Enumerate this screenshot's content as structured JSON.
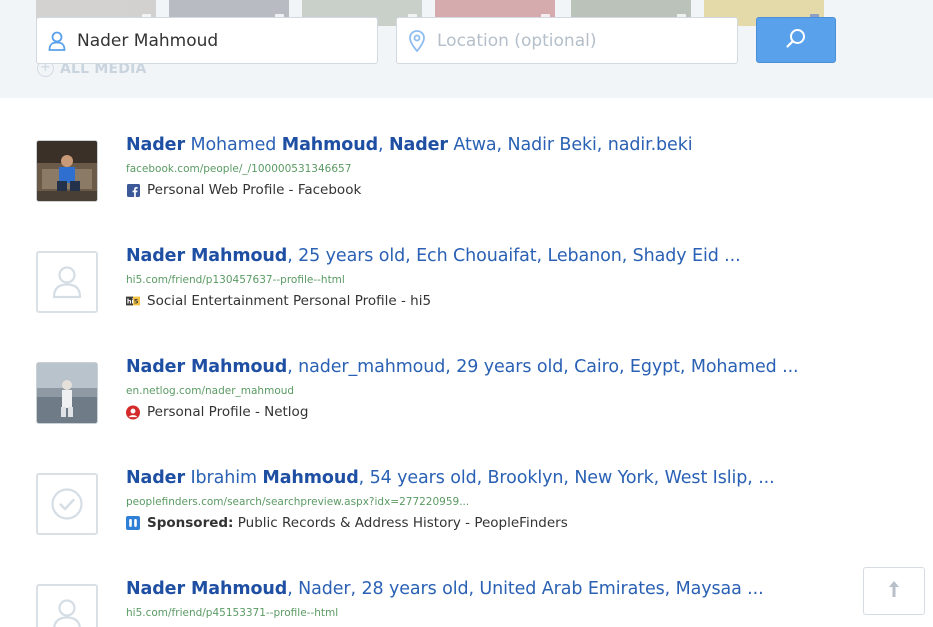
{
  "search": {
    "name_value": "Nader Mahmoud",
    "location_placeholder": "Location (optional)",
    "all_media_label": "ALL MEDIA"
  },
  "colors": {
    "accent": "#5aa1ec",
    "link": "#2a61b4",
    "url": "#5a9a63"
  },
  "results": [
    {
      "title_parts": [
        {
          "text": "Nader",
          "bold": true
        },
        {
          "text": " Mohamed ",
          "bold": false
        },
        {
          "text": "Mahmoud",
          "bold": true
        },
        {
          "text": ", ",
          "bold": false
        },
        {
          "text": "Nader",
          "bold": true
        },
        {
          "text": " Atwa, Nadir Beki, nadir.beki",
          "bold": false
        }
      ],
      "url": "facebook.com/people/_/100000531346657",
      "source_prefix": "",
      "source": "Personal Web Profile - Facebook",
      "source_icon": "facebook-icon",
      "avatar": "photo"
    },
    {
      "title_parts": [
        {
          "text": "Nader Mahmoud",
          "bold": true
        },
        {
          "text": ", 25 years old, Ech Chouaifat, Lebanon, Shady Eid ...",
          "bold": false
        }
      ],
      "url": "hi5.com/friend/p130457637--profile--html",
      "source_prefix": "",
      "source": "Social Entertainment Personal Profile - hi5",
      "source_icon": "hi5-icon",
      "avatar": "placeholder"
    },
    {
      "title_parts": [
        {
          "text": "Nader Mahmoud",
          "bold": true
        },
        {
          "text": ", nader_mahmoud, 29 years old, Cairo, Egypt, Mohamed ...",
          "bold": false
        }
      ],
      "url": "en.netlog.com/nader_mahmoud",
      "source_prefix": "",
      "source": "Personal Profile - Netlog",
      "source_icon": "netlog-icon",
      "avatar": "photo"
    },
    {
      "title_parts": [
        {
          "text": "Nader",
          "bold": true
        },
        {
          "text": " Ibrahim ",
          "bold": false
        },
        {
          "text": "Mahmoud",
          "bold": true
        },
        {
          "text": ", 54 years old, Brooklyn, New York, West Islip, ...",
          "bold": false
        }
      ],
      "url": "peoplefinders.com/search/searchpreview.aspx?idx=277220959...",
      "source_prefix": "Sponsored:",
      "source": " Public Records & Address History - PeopleFinders",
      "source_icon": "peoplefinders-icon",
      "avatar": "check"
    },
    {
      "title_parts": [
        {
          "text": "Nader Mahmoud",
          "bold": true
        },
        {
          "text": ", Nader, 28 years old, United Arab Emirates, Maysaa ...",
          "bold": false
        }
      ],
      "url": "hi5.com/friend/p45153371--profile--html",
      "source_prefix": "",
      "source": "",
      "source_icon": "",
      "avatar": "placeholder"
    }
  ]
}
